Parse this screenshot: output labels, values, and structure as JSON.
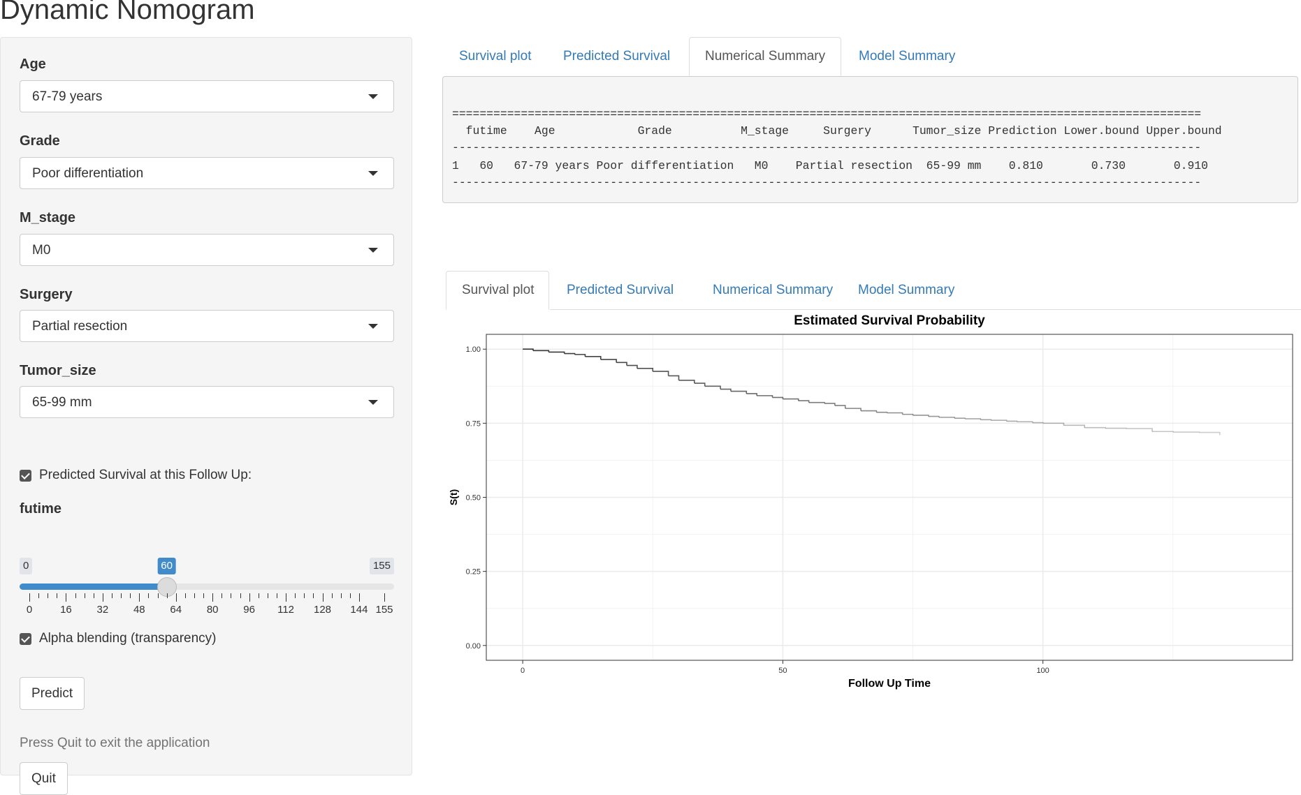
{
  "app": {
    "title": "Dynamic Nomogram"
  },
  "sidebar": {
    "age": {
      "label": "Age",
      "value": "67-79 years"
    },
    "grade": {
      "label": "Grade",
      "value": "Poor differentiation"
    },
    "m_stage": {
      "label": "M_stage",
      "value": "M0"
    },
    "surgery": {
      "label": "Surgery",
      "value": "Partial resection"
    },
    "tumor_size": {
      "label": "Tumor_size",
      "value": "65-99 mm"
    },
    "predicted_checkbox": {
      "label": "Predicted Survival at this Follow Up:",
      "checked": true
    },
    "futime": {
      "label": "futime",
      "min": 0,
      "max": 155,
      "value": 60,
      "min_label": "0",
      "max_label": "155",
      "value_label": "60",
      "tick_labels": [
        "0",
        "16",
        "32",
        "48",
        "64",
        "80",
        "96",
        "112",
        "128",
        "144",
        "155"
      ]
    },
    "alpha_checkbox": {
      "label": "Alpha blending (transparency)",
      "checked": true
    },
    "predict_button": "Predict",
    "quit_help": "Press Quit to exit the application",
    "quit_button": "Quit"
  },
  "top_tabs": {
    "active": "Numerical Summary",
    "items": [
      "Survival plot",
      "Predicted Survival",
      "Numerical Summary",
      "Model Summary"
    ]
  },
  "summary": {
    "rule_double": "=============================================================================================================",
    "header": "  futime    Age            Grade          M_stage     Surgery      Tumor_size Prediction Lower.bound Upper.bound",
    "rule_single": "-------------------------------------------------------------------------------------------------------------",
    "row": "1   60   67-79 years Poor differentiation   M0    Partial resection  65-99 mm    0.810       0.730       0.910",
    "rule_bottom": "-------------------------------------------------------------------------------------------------------------"
  },
  "bottom_tabs": {
    "active": "Survival plot",
    "items": [
      "Survival plot",
      "Predicted Survival",
      "Numerical Summary",
      "Model Summary"
    ]
  },
  "chart_data": {
    "type": "line",
    "title": "Estimated Survival Probability",
    "xlabel": "Follow Up Time",
    "ylabel": "S(t)",
    "xlim": [
      -7,
      148
    ],
    "ylim": [
      -0.05,
      1.05
    ],
    "x_ticks": [
      0,
      50,
      100
    ],
    "y_ticks": [
      0.0,
      0.25,
      0.5,
      0.75,
      1.0
    ],
    "y_tick_labels": [
      "0.00",
      "0.25",
      "0.50",
      "0.75",
      "1.00"
    ],
    "grid": true,
    "series": [
      {
        "name": "",
        "color": "#333333",
        "alpha_blending": true,
        "x": [
          0,
          2,
          5,
          8,
          10,
          12,
          15,
          18,
          20,
          22,
          25,
          28,
          30,
          33,
          35,
          38,
          40,
          43,
          45,
          48,
          50,
          53,
          55,
          58,
          60,
          62,
          65,
          68,
          70,
          73,
          75,
          78,
          80,
          83,
          85,
          88,
          90,
          93,
          95,
          98,
          100,
          104,
          108,
          112,
          116,
          121,
          125,
          130,
          134
        ],
        "y": [
          1.0,
          0.995,
          0.99,
          0.985,
          0.982,
          0.975,
          0.965,
          0.955,
          0.945,
          0.935,
          0.925,
          0.91,
          0.895,
          0.885,
          0.875,
          0.865,
          0.858,
          0.85,
          0.843,
          0.837,
          0.832,
          0.826,
          0.82,
          0.817,
          0.81,
          0.8,
          0.792,
          0.787,
          0.785,
          0.78,
          0.777,
          0.773,
          0.77,
          0.767,
          0.765,
          0.762,
          0.76,
          0.757,
          0.755,
          0.752,
          0.75,
          0.743,
          0.735,
          0.733,
          0.732,
          0.722,
          0.72,
          0.719,
          0.71
        ]
      }
    ]
  }
}
